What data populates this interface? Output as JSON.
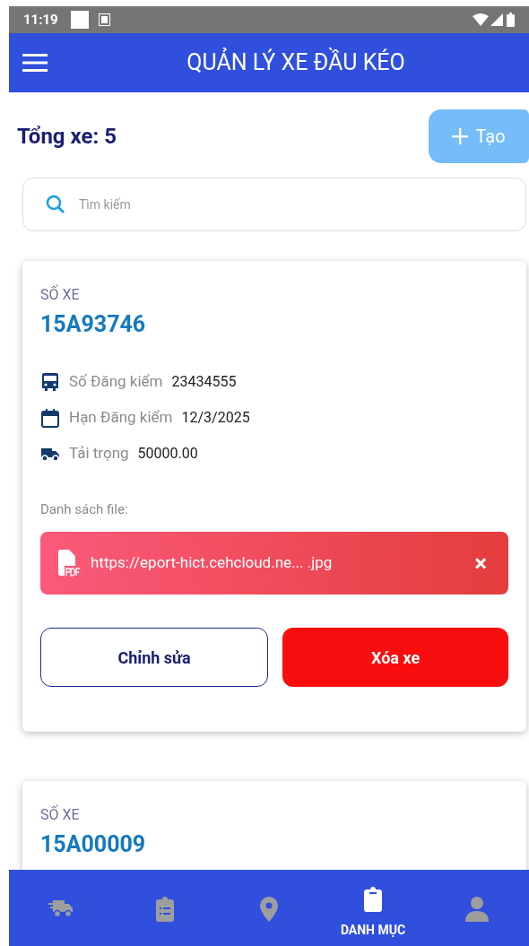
{
  "status_bar": {
    "time": "11:19"
  },
  "app_bar": {
    "title": "QUẢN LÝ XE ĐẦU KÉO"
  },
  "summary": {
    "total": "Tổng xe: 5",
    "create_button": "Tạo"
  },
  "search": {
    "placeholder": "Tìm kiếm"
  },
  "vehicles": [
    {
      "plate_label": "SỐ XE",
      "plate": "15A93746",
      "details": [
        {
          "kind": "bus",
          "label": "Số Đăng kiểm",
          "value": "23434555"
        },
        {
          "kind": "calendar",
          "label": "Hạn Đăng kiểm",
          "value": "12/3/2025"
        },
        {
          "kind": "truck",
          "label": "Tải trọng",
          "value": "50000.00"
        }
      ],
      "files_label": "Danh sách file:",
      "files": [
        {
          "name": "https://eport-hict.cehcloud.ne... .jpg",
          "close": "×"
        }
      ],
      "edit_button": "Chỉnh sửa",
      "delete_button": "Xóa xe"
    },
    {
      "plate_label": "SỐ XE",
      "plate": "15A00009"
    }
  ],
  "bottom_nav": [
    {
      "kind": "truck",
      "selected": false
    },
    {
      "kind": "clipboard-list",
      "selected": false
    },
    {
      "kind": "pin",
      "selected": false
    },
    {
      "kind": "clipboard",
      "selected": true,
      "label": "DANH MỤC"
    },
    {
      "kind": "person",
      "selected": false
    }
  ]
}
